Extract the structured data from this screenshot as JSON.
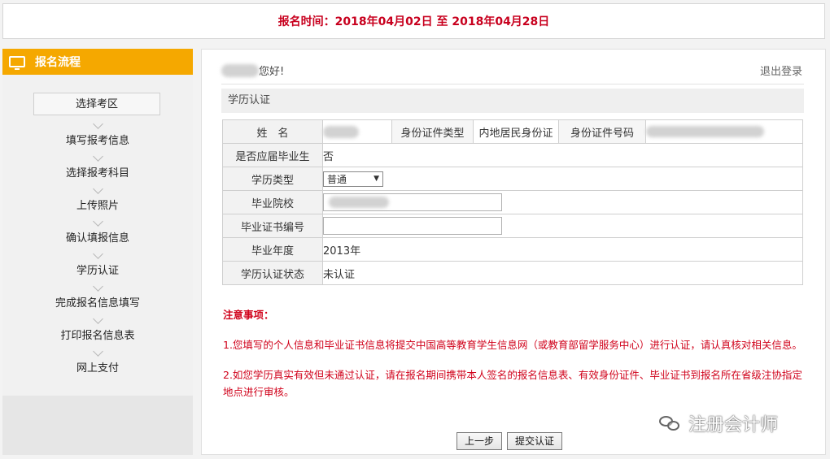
{
  "header": {
    "reg_time": "报名时间：2018年04月02日 至 2018年04月28日"
  },
  "sidebar": {
    "title": "报名流程",
    "steps": [
      {
        "label": "选择考区"
      },
      {
        "label": "填写报考信息"
      },
      {
        "label": "选择报考科目"
      },
      {
        "label": "上传照片"
      },
      {
        "label": "确认填报信息"
      },
      {
        "label": "学历认证"
      },
      {
        "label": "完成报名信息填写"
      },
      {
        "label": "打印报名信息表"
      },
      {
        "label": "网上支付"
      }
    ]
  },
  "main": {
    "greeting": "您好!",
    "logout": "退出登录",
    "section_title": "学历认证",
    "form": {
      "name_label": "姓　名",
      "id_type_label": "身份证件类型",
      "id_type_value": "内地居民身份证",
      "id_no_label": "身份证件号码",
      "fresh_grad_label": "是否应届毕业生",
      "fresh_grad_value": "否",
      "edu_type_label": "学历类型",
      "edu_type_value": "普通",
      "school_label": "毕业院校",
      "cert_no_label": "毕业证书编号",
      "cert_no_value": "",
      "grad_year_label": "毕业年度",
      "grad_year_value": "2013年",
      "status_label": "学历认证状态",
      "status_value": "未认证"
    },
    "notes": {
      "title": "注意事项：",
      "item1": "1.您填写的个人信息和毕业证书信息将提交中国高等教育学生信息网（或教育部留学服务中心）进行认证，请认真核对相关信息。",
      "item2": "2.如您学历真实有效但未通过认证，请在报名期间携带本人签名的报名信息表、有效身份证件、毕业证书到报名所在省级注协指定地点进行审核。"
    },
    "buttons": {
      "prev": "上一步",
      "submit": "提交认证"
    }
  },
  "watermark": {
    "text": "注册会计师"
  },
  "colors": {
    "accent": "#f5a800",
    "alert": "#c8001e"
  }
}
